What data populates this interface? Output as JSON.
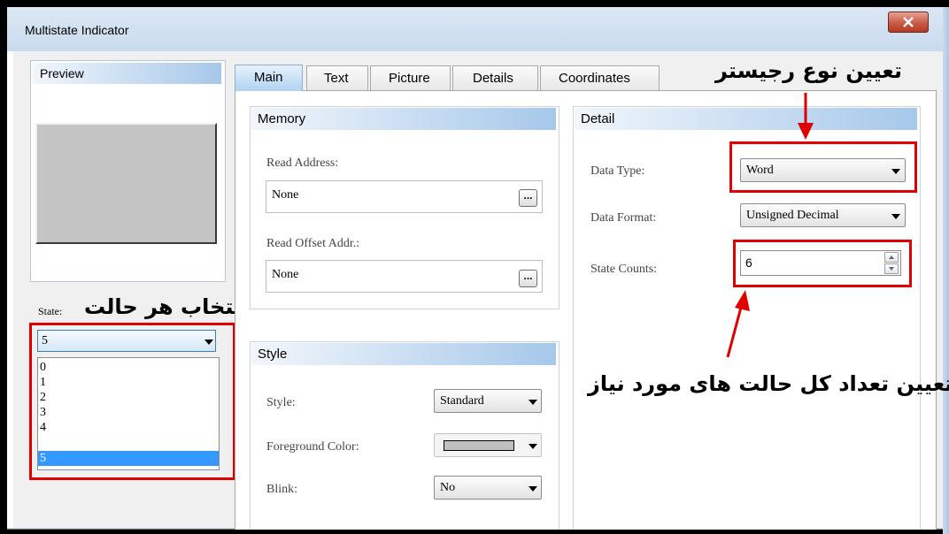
{
  "window": {
    "title": "Multistate Indicator"
  },
  "preview": {
    "label": "Preview"
  },
  "state": {
    "label": "State:",
    "annotation": "انتخاب هر حالت",
    "selected": "5",
    "options": [
      "0",
      "1",
      "2",
      "3",
      "4",
      "5"
    ]
  },
  "tabs": [
    "Main",
    "Text",
    "Picture",
    "Details",
    "Coordinates"
  ],
  "memory": {
    "header": "Memory",
    "read_address_label": "Read Address:",
    "read_address_value": "None",
    "read_offset_label": "Read Offset Addr.:",
    "read_offset_value": "None",
    "browse_label": "..."
  },
  "detail": {
    "header": "Detail",
    "data_type_label": "Data Type:",
    "data_type_value": "Word",
    "data_format_label": "Data Format:",
    "data_format_value": "Unsigned Decimal",
    "state_counts_label": "State Counts:",
    "state_counts_value": "6"
  },
  "style": {
    "header": "Style",
    "style_label": "Style:",
    "style_value": "Standard",
    "fg_color_label": "Foreground Color:",
    "fg_color_value": "#c0c0c0",
    "blink_label": "Blink:",
    "blink_value": "No"
  },
  "annotations": {
    "register_type": "تعیین نوع رجیستر",
    "state_count": "تعیین تعداد کل حالت های مورد نیاز"
  },
  "colors": {
    "highlight_red": "#e00000",
    "selection_blue": "#3399ff"
  }
}
